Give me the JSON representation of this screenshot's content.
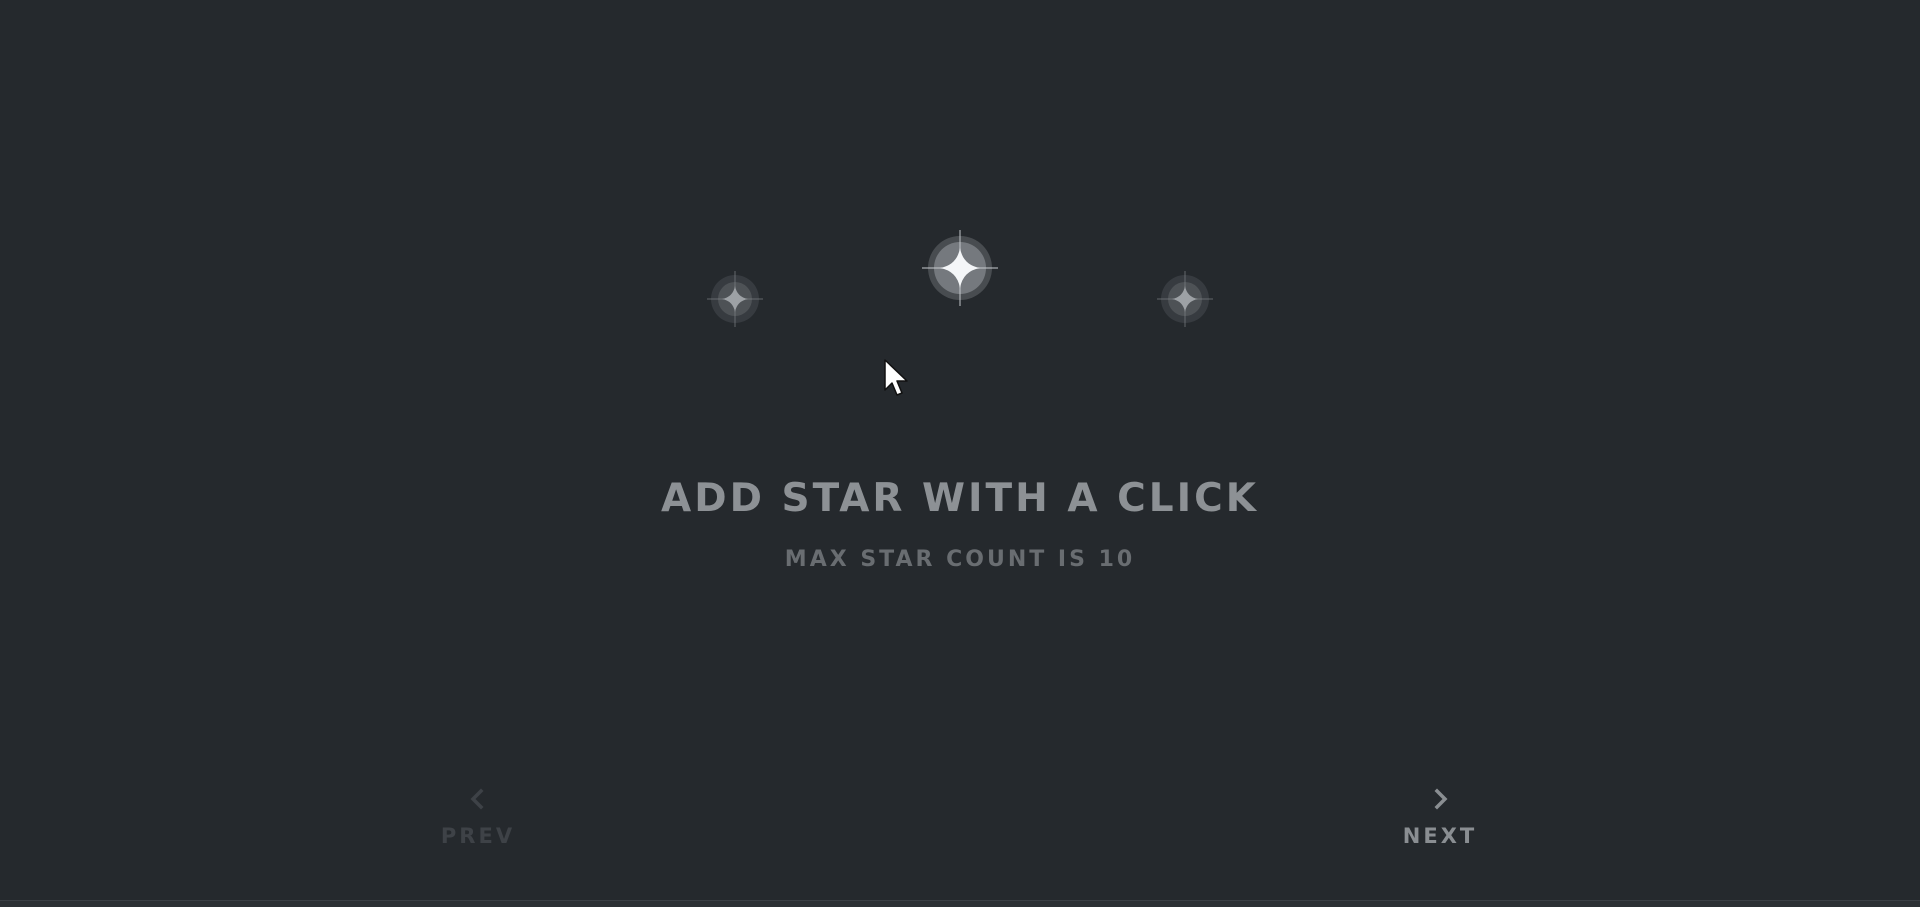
{
  "headline": "ADD STAR WITH A CLICK",
  "subline": "MAX STAR COUNT IS 10",
  "nav": {
    "prev_label": "PREV",
    "next_label": "NEXT"
  },
  "colors": {
    "background": "#25292d",
    "headline": "#8d9195",
    "subline": "#696d71",
    "prev_disabled": "#3e4247",
    "next": "#8a8e92",
    "star_bright": "#f4f6f8",
    "star_dim": "#9da1a5"
  },
  "icons": {
    "prev": "chevron-left-icon",
    "next": "chevron-right-icon",
    "star": "sparkle-star-icon",
    "cursor": "mouse-pointer-icon"
  }
}
